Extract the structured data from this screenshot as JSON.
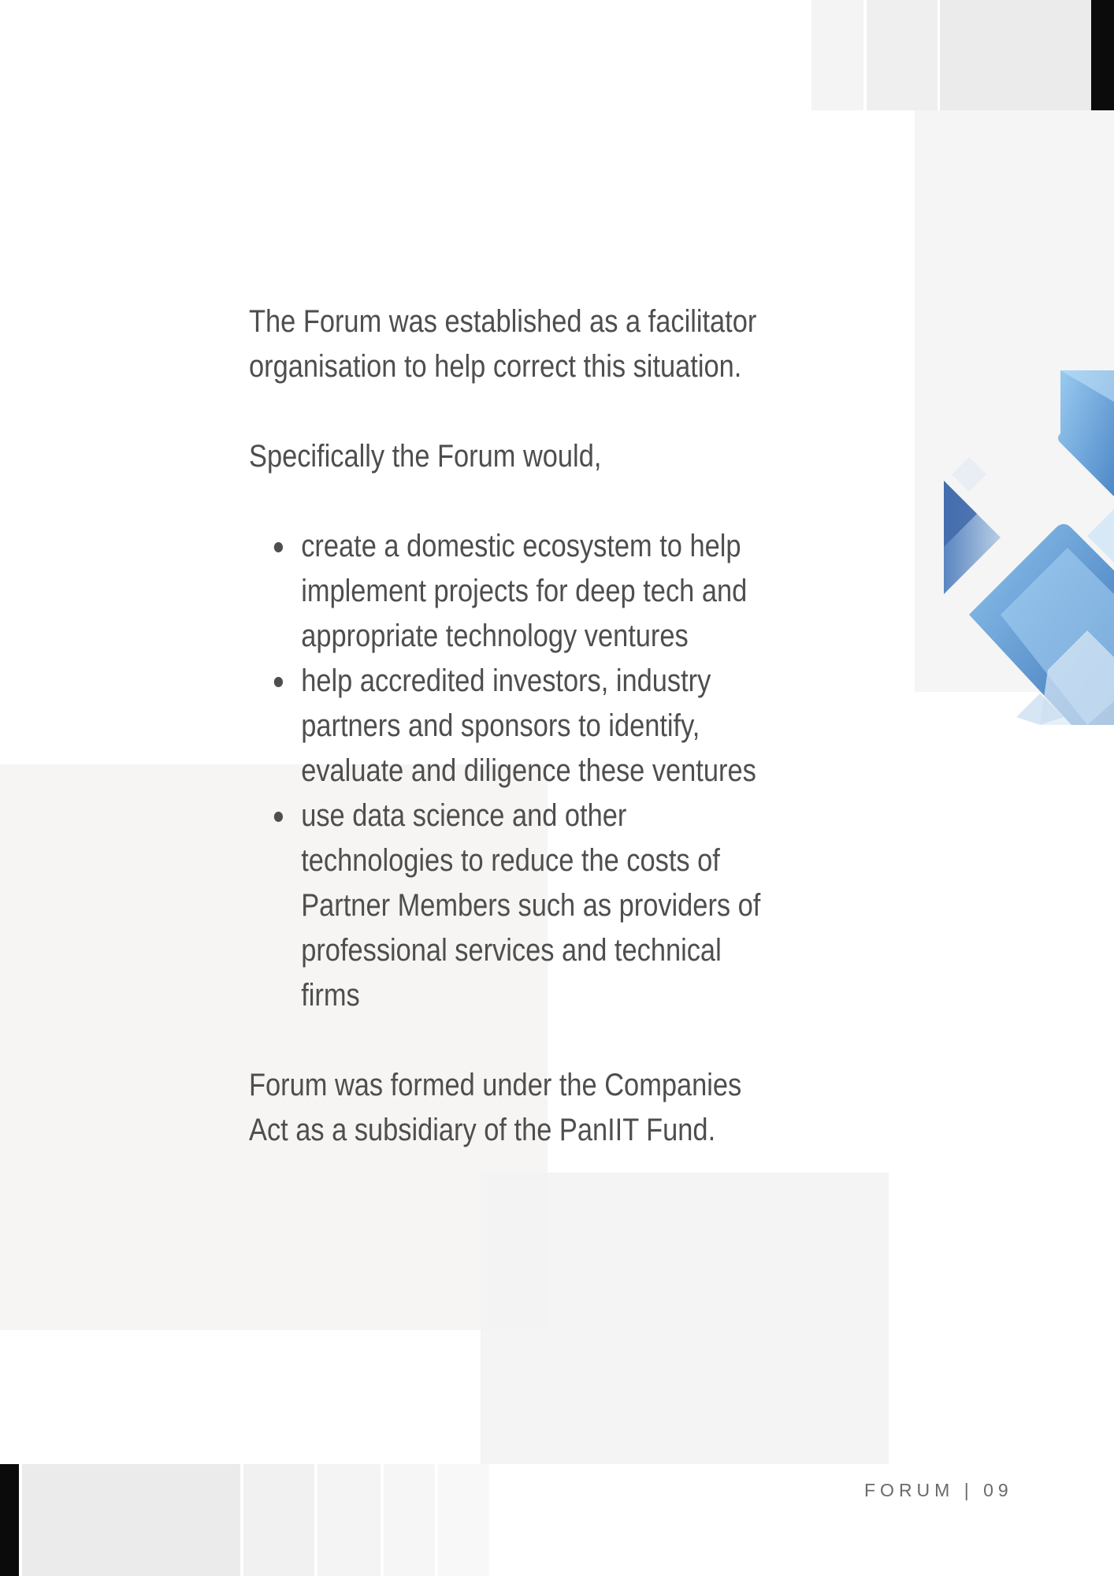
{
  "paragraphs": {
    "intro": "The Forum was established as a facilitator organisation to help correct this situation.",
    "lead": "Specifically the Forum would,",
    "closing": "Forum was formed under the Companies Act as a subsidiary of the PanIIT Fund."
  },
  "bullets": [
    "create a domestic ecosystem to help implement projects for deep tech and appropriate technology ventures",
    "help accredited investors, industry partners and sponsors to identify, evaluate and diligence these ventures",
    "use data science and other technologies to reduce the costs of Partner Members such as providers of professional services and technical firms"
  ],
  "footer": {
    "label": "FORUM",
    "separator": "|",
    "page_number": "09"
  },
  "colors": {
    "text": "#4e4e4e",
    "accent_blue": "#6aa6dc",
    "black_bar": "#0b0b0b"
  },
  "icons": [
    "blue-diamond-graphic"
  ]
}
